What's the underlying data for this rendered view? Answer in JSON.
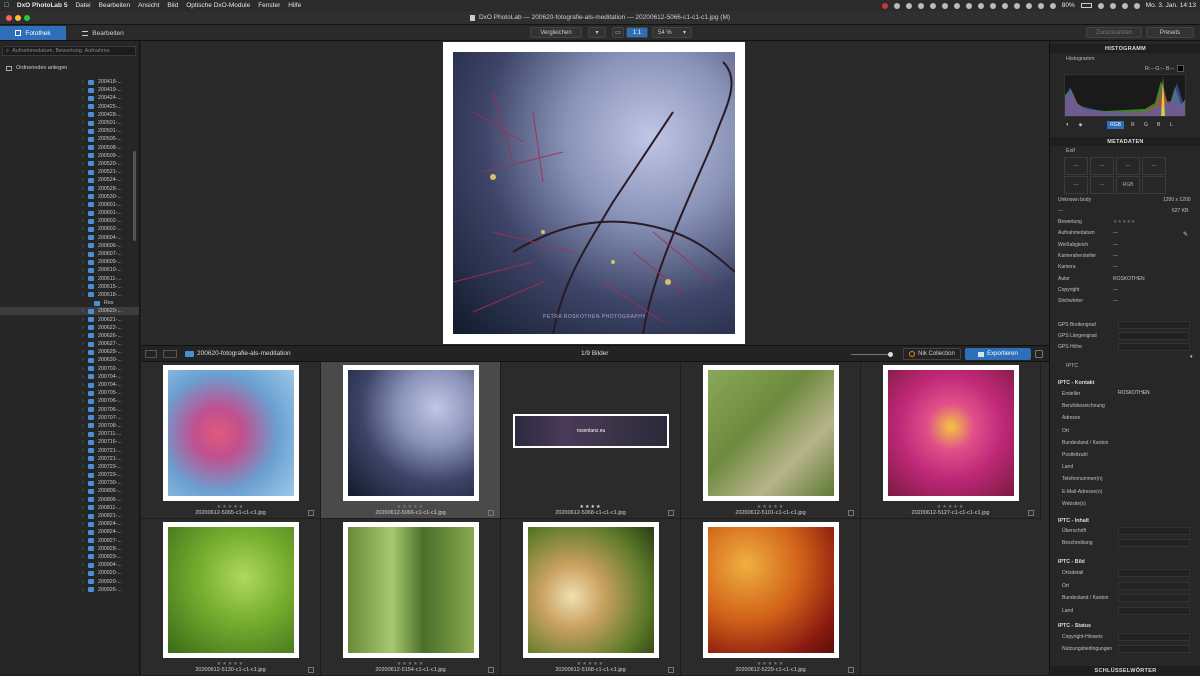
{
  "menubar": {
    "app": "DxO PhotoLab 5",
    "items": [
      "Datei",
      "Bearbeiten",
      "Ansicht",
      "Bild",
      "Optische DxO-Module",
      "Fenster",
      "Hilfe"
    ],
    "battery": "80%",
    "datetime": "Mo. 3. Jan.  14:13"
  },
  "window": {
    "title": "DxO PhotoLab — 200620-fotografie-als-meditation — 20200612-5066-c1-c1-c1.jpg (M)"
  },
  "toolbar": {
    "tab_library": "Fotothek",
    "tab_edit": "Bearbeiten",
    "compare": "Vergleichen",
    "zoom_1to1": "1:1",
    "zoom_pct": "54 %",
    "reset": "Zurücksetzen",
    "presets": "Presets"
  },
  "left": {
    "search_placeholder": "Aufnahmedatum, Bewertung, Aufnahme",
    "index_label": "Ordnerindex anlegen",
    "folders": [
      {
        "name": "200418-..."
      },
      {
        "name": "200419-..."
      },
      {
        "name": "200424-..."
      },
      {
        "name": "200425-..."
      },
      {
        "name": "200428-..."
      },
      {
        "name": "200501-..."
      },
      {
        "name": "200501-..."
      },
      {
        "name": "200505-..."
      },
      {
        "name": "200508-..."
      },
      {
        "name": "200509-..."
      },
      {
        "name": "200520-..."
      },
      {
        "name": "200521-..."
      },
      {
        "name": "200524-..."
      },
      {
        "name": "200528-..."
      },
      {
        "name": "200530-..."
      },
      {
        "name": "200601-..."
      },
      {
        "name": "200601-..."
      },
      {
        "name": "200602-..."
      },
      {
        "name": "200602-..."
      },
      {
        "name": "200604-..."
      },
      {
        "name": "200606-..."
      },
      {
        "name": "200607-..."
      },
      {
        "name": "200609-..."
      },
      {
        "name": "200610-..."
      },
      {
        "name": "200611-..."
      },
      {
        "name": "200615-..."
      },
      {
        "name": "200618-..."
      },
      {
        "name": "Res",
        "child": true
      },
      {
        "name": "200620-...",
        "selected": true
      },
      {
        "name": "200621-..."
      },
      {
        "name": "200622-..."
      },
      {
        "name": "200626-..."
      },
      {
        "name": "200627-..."
      },
      {
        "name": "200628-..."
      },
      {
        "name": "200630-..."
      },
      {
        "name": "200702-..."
      },
      {
        "name": "200704-..."
      },
      {
        "name": "200704-..."
      },
      {
        "name": "200705-..."
      },
      {
        "name": "200706-..."
      },
      {
        "name": "200706-..."
      },
      {
        "name": "200707-..."
      },
      {
        "name": "200708-..."
      },
      {
        "name": "200711-..."
      },
      {
        "name": "200716-..."
      },
      {
        "name": "200721-..."
      },
      {
        "name": "200721-..."
      },
      {
        "name": "200729-..."
      },
      {
        "name": "200729-..."
      },
      {
        "name": "200730-..."
      },
      {
        "name": "200806-..."
      },
      {
        "name": "200806-..."
      },
      {
        "name": "200811-..."
      },
      {
        "name": "200821-..."
      },
      {
        "name": "200824-..."
      },
      {
        "name": "200824-..."
      },
      {
        "name": "200827-..."
      },
      {
        "name": "200828-..."
      },
      {
        "name": "200829-..."
      },
      {
        "name": "200904-..."
      },
      {
        "name": "200920-..."
      },
      {
        "name": "200920-..."
      },
      {
        "name": "200926-..."
      }
    ]
  },
  "viewer": {
    "watermark": "PETRA ROSKOTHEN PHOTOGRAPHY"
  },
  "strip": {
    "folder": "200620-fotografie-als-meditation",
    "count": "1/9 Bilder",
    "nik": "Nik Collection",
    "export": "Exportieren"
  },
  "thumbs": [
    {
      "file": "20200612-5065-c1-c1-c1.jpg",
      "stars": "★★★★★",
      "rating": 0
    },
    {
      "file": "20200612-5066-c1-c1-c1.jpg",
      "stars": "★★★★★",
      "rating": 0,
      "selected": true
    },
    {
      "file": "20200612-5068-c1-c1-c1.jpg",
      "stars": "★★★★",
      "rating": 4,
      "banner": "rosenlanz.eu"
    },
    {
      "file": "20200612-5101-c1-c1-c1.jpg",
      "stars": "★★★★★",
      "rating": 0
    },
    {
      "file": "20200612-5127-c1-c1-c1-c1.jpg",
      "stars": "★★★★★",
      "rating": 0
    },
    {
      "file": "20200612-5130-c1-c1-c1.jpg",
      "stars": "★★★★★",
      "rating": 0
    },
    {
      "file": "20200612-5154-c1-c1-c1.jpg",
      "stars": "★★★★★",
      "rating": 0
    },
    {
      "file": "20200612-5168-c1-c1-c1.jpg",
      "stars": "★★★★★",
      "rating": 0
    },
    {
      "file": "20200612-5229-c1-c1-c1.jpg",
      "stars": "★★★★★",
      "rating": 0
    }
  ],
  "right": {
    "histogram_header": "HISTOGRAMM",
    "histogram_label": "Histogramm",
    "rgb_readout": "R:-- G:-- B:--",
    "channels": [
      "RGB",
      "R",
      "G",
      "B",
      "L"
    ],
    "metadata_header": "METADATEN",
    "exif_label": "Exif",
    "exif_cells": [
      "---",
      "---",
      "---",
      "---",
      "---",
      "---",
      "RGB",
      ""
    ],
    "body": "Unknown body",
    "dims": "1200 x 1200",
    "dash": "---",
    "size": "627 KB",
    "fields": [
      {
        "label": "Bewertung",
        "value": "★★★★★"
      },
      {
        "label": "Aufnahmedatum",
        "value": "---"
      },
      {
        "label": "Weißabgleich",
        "value": "---"
      },
      {
        "label": "Kamerahersteller",
        "value": "---"
      },
      {
        "label": "Kamera",
        "value": "---"
      },
      {
        "label": "Autor",
        "value": "ROSKOTHEN"
      },
      {
        "label": "Copyright",
        "value": "---"
      },
      {
        "label": "Stichwörter",
        "value": "---"
      }
    ],
    "gps": [
      "GPS Breitengrad",
      "GPS Längengrad",
      "GPS Höhe"
    ],
    "iptc_label": "IPTC",
    "iptc_contact_title": "IPTC - Kontakt",
    "iptc_contact": [
      {
        "label": "Ersteller",
        "value": "ROSKOTHEN"
      },
      {
        "label": "Berufsbezeichnung",
        "value": ""
      },
      {
        "label": "Adresse",
        "value": ""
      },
      {
        "label": "Ort",
        "value": ""
      },
      {
        "label": "Bundesland / Kanton",
        "value": ""
      },
      {
        "label": "Postleitzahl",
        "value": ""
      },
      {
        "label": "Land",
        "value": ""
      },
      {
        "label": "Telefonnummer(n)",
        "value": ""
      },
      {
        "label": "E-Mail-Adresse(n)",
        "value": ""
      },
      {
        "label": "Website(s)",
        "value": ""
      }
    ],
    "iptc_content_title": "IPTC - Inhalt",
    "iptc_content": [
      "Überschrift",
      "Beschreibung"
    ],
    "iptc_image_title": "IPTC - Bild",
    "iptc_image": [
      "Ortsdetail",
      "Ort",
      "Bundesland / Kanton",
      "Land"
    ],
    "iptc_status_title": "IPTC - Status",
    "iptc_status": [
      "Copyright-Hinweis",
      "Nutzungsbedingungen"
    ],
    "keywords_header": "SCHLÜSSELWÖRTER"
  }
}
